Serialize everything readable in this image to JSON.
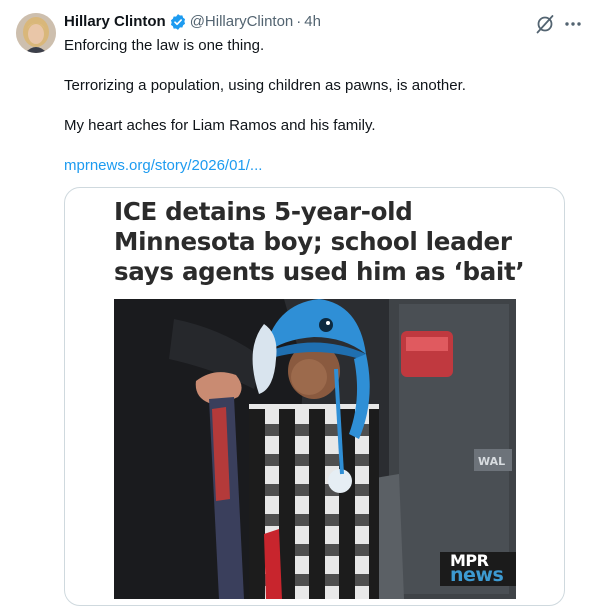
{
  "author": {
    "name": "Hillary Clinton",
    "handle": "@HillaryClinton",
    "separator": "·",
    "time": "4h",
    "verified_icon": "verified-badge-icon",
    "avatar_icon": "avatar"
  },
  "tweet": {
    "line1": "Enforcing the law is one thing.",
    "line2": "Terrorizing a population, using children as pawns, is another.",
    "line3": "My heart aches for Liam Ramos and his family.",
    "link": "mprnews.org/story/2026/01/..."
  },
  "card": {
    "headline_lines": [
      "ICE detains 5-year-old",
      "Minnesota boy; school leader",
      "says agents used him as ‘bait’"
    ],
    "logo_top": "MPR",
    "logo_bottom": "news",
    "vehicle_badge": "WAL"
  },
  "actions": {
    "grok_icon": "grok-icon",
    "more_icon": "more-icon"
  },
  "colors": {
    "link": "#1d9bf0",
    "verified": "#1d9bf0",
    "text": "#0f1419",
    "muted": "#536471",
    "card_border": "#cfd9de",
    "headline": "#2b2b2b",
    "logo_news": "#3d9ad1"
  }
}
